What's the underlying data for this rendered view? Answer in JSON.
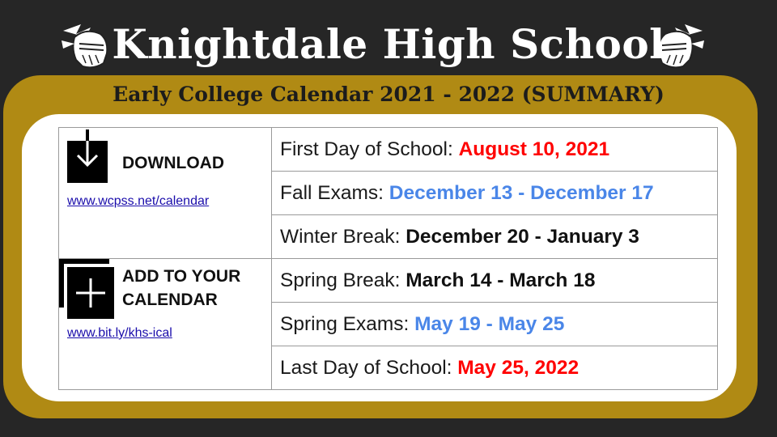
{
  "header": {
    "title": "Knightdale High School",
    "subtitle": "Early College Calendar 2021 - 2022 (SUMMARY)",
    "icons": [
      "knight-helmet-icon",
      "knight-helmet-icon"
    ]
  },
  "download": {
    "label": "DOWNLOAD",
    "link": "www.wcpss.net/calendar",
    "icon": "download-icon"
  },
  "add_calendar": {
    "label_line1": "ADD TO YOUR",
    "label_line2": "CALENDAR",
    "link": "www.bit.ly/khs-ical",
    "icon": "add-calendar-icon"
  },
  "events": [
    {
      "label": "First Day of School: ",
      "date": "August 10, 2021",
      "color": "#ff0000"
    },
    {
      "label": "Fall Exams: ",
      "date": "December 13 - December 17",
      "color": "#4a86e8"
    },
    {
      "label": "Winter Break: ",
      "date": "December 20 - January 3",
      "color": "#111111"
    },
    {
      "label": "Spring Break: ",
      "date": "March 14 - March 18",
      "color": "#111111"
    },
    {
      "label": "Spring Exams: ",
      "date": "May 19 - May 25",
      "color": "#4a86e8"
    },
    {
      "label": "Last Day of School: ",
      "date": "May 25, 2022",
      "color": "#ff0000"
    }
  ],
  "colors": {
    "background": "#262626",
    "gold": "#b08a14",
    "red": "#ff0000",
    "blue": "#4a86e8"
  }
}
